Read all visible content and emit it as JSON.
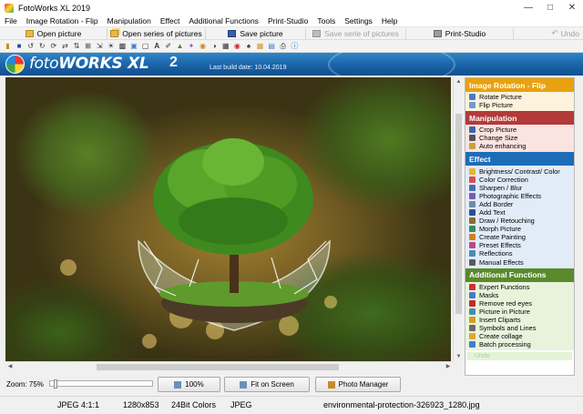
{
  "window": {
    "title": "FotoWorks XL 2019"
  },
  "menu": {
    "items": [
      "File",
      "Image Rotation - Flip",
      "Manipulation",
      "Effect",
      "Additional Functions",
      "Print-Studio",
      "Tools",
      "Settings",
      "Help"
    ]
  },
  "buttonbar": {
    "open_picture": "Open picture",
    "open_series": "Open series of pictures",
    "save_picture": "Save picture",
    "save_series": "Save serie of pictures",
    "print_studio": "Print-Studio",
    "undo": "Undo",
    "expert_functions": "Expert Functions"
  },
  "banner": {
    "brand_light": "foto",
    "brand_bold": "WORKS",
    "brand_xl": "XL",
    "version": "2",
    "build_date": "Last build date: 10.04.2019"
  },
  "panel": {
    "sections": [
      {
        "title": "Image Rotation - Flip",
        "color": "#e8a10f",
        "items": [
          "Rotate Picture",
          "Flip Picture"
        ]
      },
      {
        "title": "Manipulation",
        "color": "#b23a3a",
        "items": [
          "Crop Picture",
          "Change Size",
          "Auto enhancing"
        ]
      },
      {
        "title": "Effect",
        "color": "#1d6cb8",
        "items": [
          "Brightness/ Contrast/ Color",
          "Color Correction",
          "Sharpen / Blur",
          "Photographic Effects",
          "Add Border",
          "Add Text",
          "Draw / Retouching",
          "Morph Picture",
          "Create Painting",
          "Preset Effects",
          "Reflections",
          "Manual Effects"
        ]
      },
      {
        "title": "Additional Functions",
        "color": "#5a8a2c",
        "items": [
          "Expert Functions",
          "Masks",
          "Remove red eyes",
          "Picture in Picture",
          "Insert Cliparts",
          "Symbols and Lines",
          "Create collage",
          "Batch processing"
        ]
      }
    ],
    "undo": "Undo"
  },
  "zoom": {
    "label": "Zoom: 75%",
    "btn_100": "100%",
    "btn_fit": "Fit on Screen",
    "btn_manager": "Photo Manager"
  },
  "status": {
    "format": "JPEG  4:1:1",
    "dimensions": "1280x853",
    "colors": "24Bit Colors",
    "type": "JPEG",
    "filename": "environmental-protection-326923_1280.jpg"
  }
}
